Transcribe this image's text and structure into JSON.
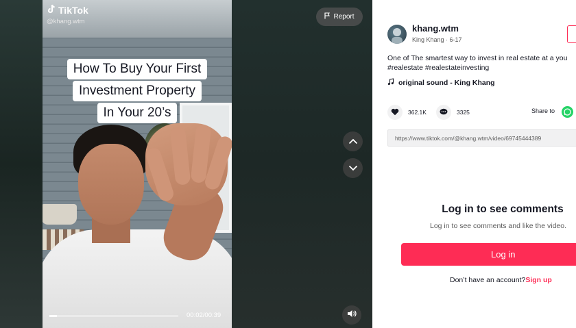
{
  "brand": {
    "name": "TikTok",
    "handle": "@khang.wtm"
  },
  "video": {
    "caption_lines": [
      "How To Buy Your First",
      "Investment Property",
      "In Your 20’s"
    ],
    "report_label": "Report",
    "time": "00:02/00:39",
    "progress": 0.06
  },
  "author": {
    "username": "khang.wtm",
    "meta": "King Khang · 6-17"
  },
  "post": {
    "description": "One of The smartest way to invest in real estate at a you",
    "tags": "#realestate #realestateinvesting",
    "sound": "original sound - King Khang"
  },
  "stats": {
    "likes": "362.1K",
    "comments": "3325",
    "share_label": "Share to"
  },
  "link": "https://www.tiktok.com/@khang.wtm/video/69745444389",
  "login": {
    "title": "Log in to see comments",
    "subtitle": "Log in to see comments and like the video.",
    "button": "Log in",
    "signup_prompt": "Don’t have an account?",
    "signup_link": "Sign up"
  },
  "colors": {
    "accent": "#fe2c55",
    "whatsapp": "#25d366"
  },
  "icons": [
    "tiktok-logo-icon",
    "flag-icon",
    "chevron-up-icon",
    "chevron-down-icon",
    "volume-icon",
    "music-note-icon",
    "heart-icon",
    "comment-icon",
    "whatsapp-icon"
  ]
}
